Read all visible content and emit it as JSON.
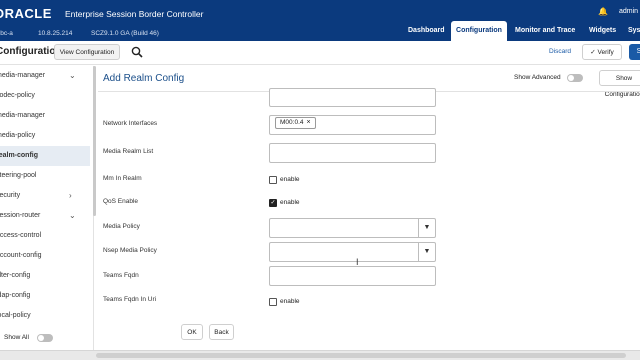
{
  "header": {
    "brand": "ORACLE",
    "product": "Enterprise Session Border Controller",
    "user": "admin",
    "notification_icon": "bell-icon",
    "system": {
      "hostname": "sbc-a",
      "ip": "10.8.25.214",
      "version": "SCZ9.1.0 GA (Build 46)"
    },
    "nav_tabs": [
      {
        "label": "Dashboard",
        "active": false
      },
      {
        "label": "Configuration",
        "active": true
      },
      {
        "label": "Monitor and Trace",
        "active": false
      },
      {
        "label": "Widgets",
        "active": false
      },
      {
        "label": "System",
        "active": false
      }
    ]
  },
  "subbar": {
    "title": "Configuration",
    "view_config": "View Configuration",
    "search_icon": "search-icon",
    "discard": "Discard",
    "verify": "Verify",
    "verify_icon": "check-circle-icon",
    "save": "S"
  },
  "sidebar": {
    "items": [
      {
        "label": "media-manager",
        "active": false,
        "chevron": "chevron-down-icon"
      },
      {
        "label": "codec-policy",
        "active": false
      },
      {
        "label": "media-manager",
        "active": false
      },
      {
        "label": "media-policy",
        "active": false
      },
      {
        "label": "realm-config",
        "active": true
      },
      {
        "label": "steering-pool",
        "active": false
      },
      {
        "label": "security",
        "active": false,
        "chevron": "chevron-right-icon"
      },
      {
        "label": "session-router",
        "active": false,
        "chevron": "chevron-down-icon"
      },
      {
        "label": "access-control",
        "active": false
      },
      {
        "label": "account-config",
        "active": false
      },
      {
        "label": "filter-config",
        "active": false
      },
      {
        "label": "ldap-config",
        "active": false
      },
      {
        "label": "local-policy",
        "active": false
      }
    ],
    "show_all": "Show All",
    "show_all_on": false
  },
  "main": {
    "title": "Add Realm Config",
    "show_advanced": "Show Advanced",
    "show_advanced_on": false,
    "show_configuration": "Show Configuration",
    "fields": {
      "network_interfaces": {
        "label": "Network Interfaces",
        "chip": "M00:0.4",
        "chip_remove": "×"
      },
      "media_realm_list": {
        "label": "Media Realm List",
        "value": ""
      },
      "mm_in_realm": {
        "label": "Mm In Realm",
        "checked": false,
        "option": "enable"
      },
      "qos_enable": {
        "label": "QoS Enable",
        "checked": true,
        "option": "enable"
      },
      "media_policy": {
        "label": "Media Policy",
        "value": ""
      },
      "nsep_media_policy": {
        "label": "Nsep Media Policy",
        "value": ""
      },
      "teams_fqdn": {
        "label": "Teams Fqdn",
        "value": ""
      },
      "teams_fqdn_in_uri": {
        "label": "Teams Fqdn In Uri",
        "checked": false,
        "option": "enable"
      }
    },
    "ok": "OK",
    "back": "Back"
  }
}
